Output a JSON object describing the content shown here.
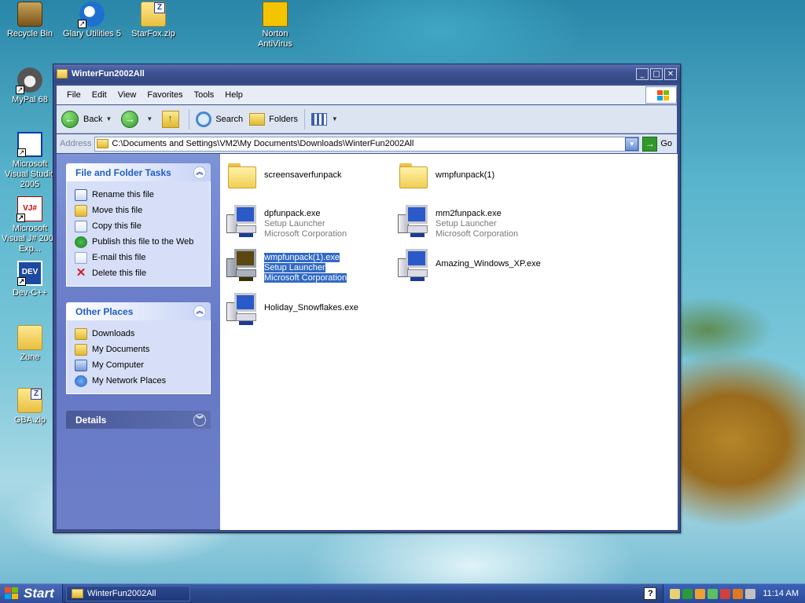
{
  "desktop": {
    "icons": [
      {
        "label": "Recycle Bin"
      },
      {
        "label": "Glary Utilities 5"
      },
      {
        "label": "StarFox.zip"
      },
      {
        "label": "Norton AntiVirus"
      },
      {
        "label": "MyPal 68"
      },
      {
        "label": "Microsoft Visual Studio 2005"
      },
      {
        "label": "Microsoft Visual J# 2005 Exp..."
      },
      {
        "label": "Dev-C++"
      },
      {
        "label": "Zune"
      },
      {
        "label": "GBA.zip"
      }
    ]
  },
  "window": {
    "title": "WinterFun2002All",
    "controls": {
      "minimize": "_",
      "maximize": "□",
      "close": "✕"
    },
    "menu": [
      "File",
      "Edit",
      "View",
      "Favorites",
      "Tools",
      "Help"
    ],
    "toolbar": {
      "back": "Back",
      "search": "Search",
      "folders": "Folders"
    },
    "address": {
      "label": "Address",
      "value": "C:\\Documents and Settings\\VM2\\My Documents\\Downloads\\WinterFun2002All",
      "go": "Go"
    },
    "task_pane": {
      "file_tasks": {
        "title": "File and Folder Tasks",
        "items": [
          "Rename this file",
          "Move this file",
          "Copy this file",
          "Publish this file to the Web",
          "E-mail this file",
          "Delete this file"
        ]
      },
      "other_places": {
        "title": "Other Places",
        "items": [
          "Downloads",
          "My Documents",
          "My Computer",
          "My Network Places"
        ]
      },
      "details": {
        "title": "Details"
      }
    },
    "files": [
      {
        "name": "screensaverfunpack",
        "type": "folder"
      },
      {
        "name": "wmpfunpack(1)",
        "type": "folder"
      },
      {
        "name": "dpfunpack.exe",
        "desc": "Setup Launcher",
        "company": "Microsoft Corporation",
        "type": "exe"
      },
      {
        "name": "mm2funpack.exe",
        "desc": "Setup Launcher",
        "company": "Microsoft Corporation",
        "type": "exe"
      },
      {
        "name": "wmpfunpack(1).exe",
        "desc": "Setup Launcher",
        "company": "Microsoft Corporation",
        "type": "exe",
        "selected": true
      },
      {
        "name": "Amazing_Windows_XP.exe",
        "type": "exe"
      },
      {
        "name": "Holiday_Snowflakes.exe",
        "type": "exe"
      }
    ]
  },
  "taskbar": {
    "start": "Start",
    "active_task": "WinterFun2002All",
    "help": "?",
    "clock": "11:14 AM"
  }
}
